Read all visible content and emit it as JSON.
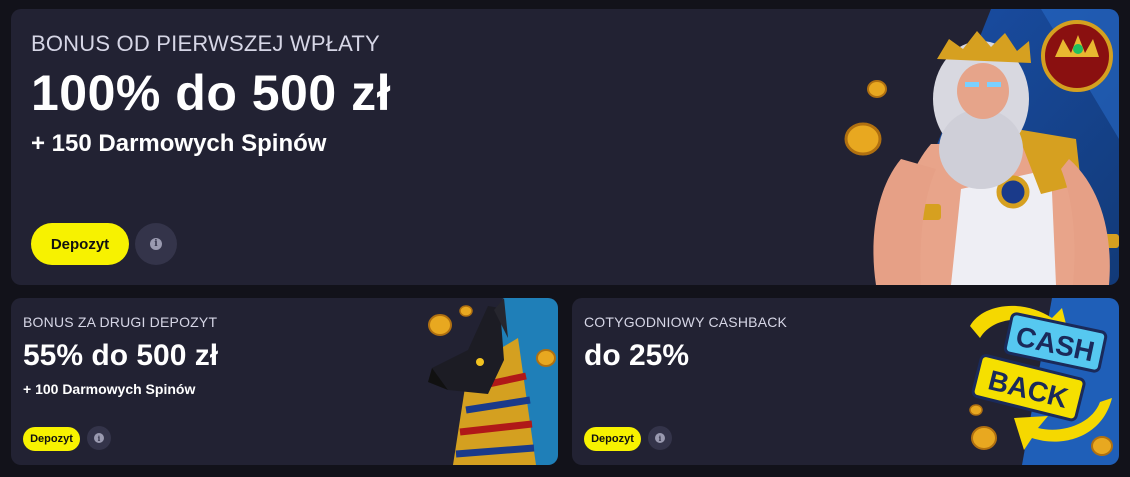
{
  "promos": {
    "main": {
      "eyebrow": "BONUS OD PIERWSZEJ WPŁATY",
      "headline": "100% do 500 zł",
      "sub": "+ 150 Darmowych Spinów",
      "deposit_label": "Depozyt",
      "info_glyph": "i"
    },
    "second": {
      "eyebrow": "BONUS ZA DRUGI DEPOZYT",
      "headline": "55% do 500 zł",
      "sub": "+ 100 Darmowych Spinów",
      "deposit_label": "Depozyt",
      "info_glyph": "i"
    },
    "cashback": {
      "eyebrow": "COTYGODNIOWY CASHBACK",
      "headline": "do 25%",
      "deposit_label": "Depozyt",
      "info_glyph": "i",
      "badge_line1": "CASH",
      "badge_line2": "BACK"
    }
  },
  "colors": {
    "card_bg": "#222233",
    "page_bg": "#12121a",
    "accent_yellow": "#f7f200",
    "art_blue": "#1f5fb8"
  },
  "icons": {
    "info": "info-icon",
    "main_art": "zeus-illustration",
    "second_art": "anubis-illustration",
    "cashback_art": "cashback-badge-illustration"
  }
}
